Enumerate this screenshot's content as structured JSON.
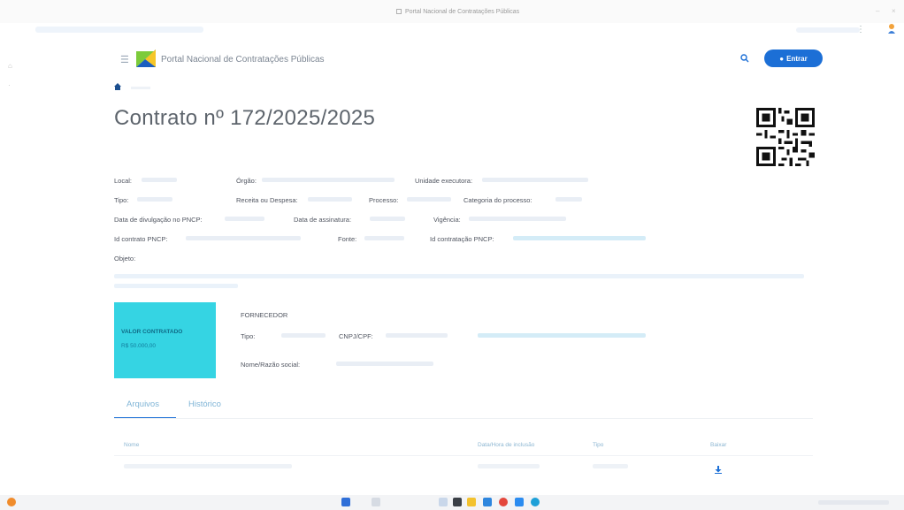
{
  "browser": {
    "tab_title": "Portal Nacional de Contratações Públicas"
  },
  "header": {
    "site_title": "Portal Nacional de Contratações Públicas",
    "enter_button": "Entrar"
  },
  "page": {
    "title": "Contrato nº 172/2025/2025"
  },
  "details": {
    "local_label": "Local:",
    "orgao_label": "Órgão:",
    "unidade_label": "Unidade executora:",
    "tipo_label": "Tipo:",
    "receita_label": "Receita ou Despesa:",
    "processo_label": "Processo:",
    "categoria_label": "Categoria do processo:",
    "divulgacao_label": "Data de divulgação no PNCP:",
    "assinatura_label": "Data de assinatura:",
    "vigencia_label": "Vigência:",
    "id_contrato_label": "Id contrato PNCP:",
    "fonte_label": "Fonte:",
    "id_contratacao_label": "Id contratação PNCP:",
    "objeto_label": "Objeto:"
  },
  "valor": {
    "label": "VALOR CONTRATADO",
    "amount": "R$ 50.000,00"
  },
  "fornecedor": {
    "heading": "FORNECEDOR",
    "tipo_label": "Tipo:",
    "cnpj_label": "CNPJ/CPF:",
    "nome_label": "Nome/Razão social:"
  },
  "tabs": [
    {
      "label": "Arquivos",
      "active": true
    },
    {
      "label": "Histórico",
      "active": false
    }
  ],
  "files_table": {
    "columns": [
      "Nome",
      "Data/Hora de inclusão",
      "Tipo",
      "Baixar"
    ]
  },
  "colors": {
    "primary": "#1c6fd6",
    "valor_card": "#35d4e3"
  }
}
